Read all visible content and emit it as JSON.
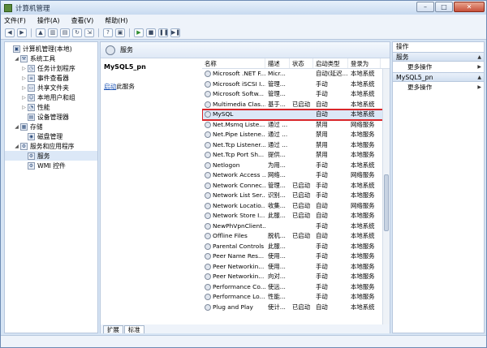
{
  "window": {
    "title": "计算机管理"
  },
  "menu": [
    "文件(F)",
    "操作(A)",
    "查看(V)",
    "帮助(H)"
  ],
  "tree": [
    {
      "label": "计算机管理(本地)",
      "depth": 0,
      "expander": "",
      "icon": "computer-icon",
      "glyph": "▣"
    },
    {
      "label": "系统工具",
      "depth": 1,
      "expander": "◢",
      "icon": "tools-icon",
      "glyph": "⚒"
    },
    {
      "label": "任务计划程序",
      "depth": 2,
      "expander": "▷",
      "icon": "clock-icon",
      "glyph": "◷"
    },
    {
      "label": "事件查看器",
      "depth": 2,
      "expander": "▷",
      "icon": "event-log-icon",
      "glyph": "≡"
    },
    {
      "label": "共享文件夹",
      "depth": 2,
      "expander": "▷",
      "icon": "folder-icon",
      "glyph": "▭"
    },
    {
      "label": "本地用户和组",
      "depth": 2,
      "expander": "▷",
      "icon": "users-icon",
      "glyph": "☺"
    },
    {
      "label": "性能",
      "depth": 2,
      "expander": "▷",
      "icon": "performance-icon",
      "glyph": "◔"
    },
    {
      "label": "设备管理器",
      "depth": 2,
      "expander": "",
      "icon": "device-icon",
      "glyph": "▤"
    },
    {
      "label": "存储",
      "depth": 1,
      "expander": "◢",
      "icon": "storage-icon",
      "glyph": "▦"
    },
    {
      "label": "磁盘管理",
      "depth": 2,
      "expander": "",
      "icon": "disk-icon",
      "glyph": "◉"
    },
    {
      "label": "服务和应用程序",
      "depth": 1,
      "expander": "◢",
      "icon": "services-apps-icon",
      "glyph": "⚙"
    },
    {
      "label": "服务",
      "depth": 2,
      "expander": "",
      "icon": "services-icon",
      "glyph": "⚙",
      "selected": true
    },
    {
      "label": "WMI 控件",
      "depth": 2,
      "expander": "",
      "icon": "wmi-icon",
      "glyph": "⚙"
    }
  ],
  "middle": {
    "header_title": "服务",
    "selected_service": "MySQL5_pn",
    "action_link": "启动",
    "action_rest": "此服务"
  },
  "columns": [
    "名称",
    "描述",
    "状态",
    "启动类型",
    "登录为"
  ],
  "services": [
    {
      "name": "Microsoft .NET F...",
      "desc": "Micr...",
      "status": "",
      "startup": "自动(延迟...",
      "logon": "本地系统"
    },
    {
      "name": "Microsoft iSCSI I...",
      "desc": "管理...",
      "status": "",
      "startup": "手动",
      "logon": "本地系统"
    },
    {
      "name": "Microsoft Softw...",
      "desc": "管理...",
      "status": "",
      "startup": "手动",
      "logon": "本地系统"
    },
    {
      "name": "Multimedia Clas...",
      "desc": "基于...",
      "status": "已启动",
      "startup": "自动",
      "logon": "本地系统"
    },
    {
      "name": "MySQL",
      "desc": "",
      "status": "",
      "startup": "自动",
      "logon": "本地系统",
      "highlight": true
    },
    {
      "name": "Net.Msmq Liste...",
      "desc": "通过 ...",
      "status": "",
      "startup": "禁用",
      "logon": "网络服务"
    },
    {
      "name": "Net.Pipe Listene...",
      "desc": "通过 ...",
      "status": "",
      "startup": "禁用",
      "logon": "本地服务"
    },
    {
      "name": "Net.Tcp Listener...",
      "desc": "通过 ...",
      "status": "",
      "startup": "禁用",
      "logon": "本地服务"
    },
    {
      "name": "Net.Tcp Port Sh...",
      "desc": "提供...",
      "status": "",
      "startup": "禁用",
      "logon": "本地服务"
    },
    {
      "name": "Netlogon",
      "desc": "为用...",
      "status": "",
      "startup": "手动",
      "logon": "本地系统"
    },
    {
      "name": "Network Access ...",
      "desc": "网络...",
      "status": "",
      "startup": "手动",
      "logon": "网络服务"
    },
    {
      "name": "Network Connec...",
      "desc": "管理...",
      "status": "已启动",
      "startup": "手动",
      "logon": "本地系统"
    },
    {
      "name": "Network List Ser...",
      "desc": "识别...",
      "status": "已启动",
      "startup": "手动",
      "logon": "本地服务"
    },
    {
      "name": "Network Locatio...",
      "desc": "收集...",
      "status": "已启动",
      "startup": "自动",
      "logon": "网络服务"
    },
    {
      "name": "Network Store I...",
      "desc": "此服...",
      "status": "已启动",
      "startup": "自动",
      "logon": "本地服务"
    },
    {
      "name": "NewPhVpnClient...",
      "desc": "",
      "status": "",
      "startup": "手动",
      "logon": "本地系统"
    },
    {
      "name": "Offline Files",
      "desc": "脱机...",
      "status": "已启动",
      "startup": "自动",
      "logon": "本地系统"
    },
    {
      "name": "Parental Controls",
      "desc": "此服...",
      "status": "",
      "startup": "手动",
      "logon": "本地服务"
    },
    {
      "name": "Peer Name Res...",
      "desc": "使用...",
      "status": "",
      "startup": "手动",
      "logon": "本地服务"
    },
    {
      "name": "Peer Networkin...",
      "desc": "使用...",
      "status": "",
      "startup": "手动",
      "logon": "本地服务"
    },
    {
      "name": "Peer Networkin...",
      "desc": "向对...",
      "status": "",
      "startup": "手动",
      "logon": "本地服务"
    },
    {
      "name": "Performance Co...",
      "desc": "使远...",
      "status": "",
      "startup": "手动",
      "logon": "本地服务"
    },
    {
      "name": "Performance Lo...",
      "desc": "性能...",
      "status": "",
      "startup": "手动",
      "logon": "本地服务"
    },
    {
      "name": "Plug and Play",
      "desc": "使计...",
      "status": "已启动",
      "startup": "自动",
      "logon": "本地系统"
    }
  ],
  "tabs": [
    "扩展",
    "标准"
  ],
  "right": {
    "header": "操作",
    "sections": [
      {
        "title": "服务",
        "items": [
          "更多操作"
        ]
      },
      {
        "title": "MySQL5_pn",
        "items": [
          "更多操作"
        ]
      }
    ]
  }
}
